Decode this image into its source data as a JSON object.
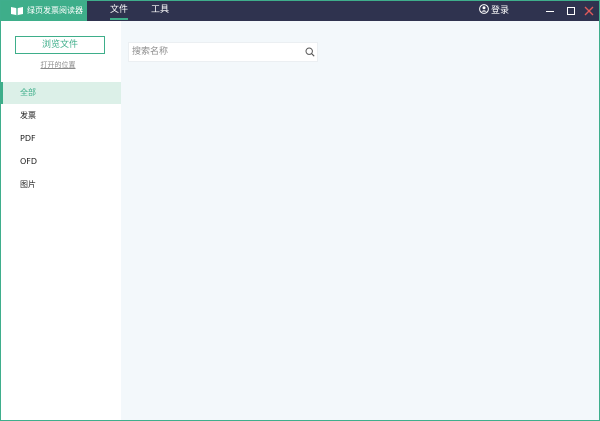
{
  "app": {
    "title": "绿页发票阅读器"
  },
  "menu": {
    "file_label": "文件",
    "tools_label": "工具"
  },
  "account": {
    "login_label": "登录"
  },
  "sidebar": {
    "browse_label": "浏览文件",
    "open_location_label": "打开的位置",
    "categories": [
      {
        "label": "全部",
        "active": true
      },
      {
        "label": "发票",
        "active": false
      },
      {
        "label": "PDF",
        "active": false
      },
      {
        "label": "OFD",
        "active": false
      },
      {
        "label": "图片",
        "active": false
      }
    ]
  },
  "search": {
    "placeholder": "搜索名称",
    "value": ""
  },
  "colors": {
    "accent": "#3eae8a",
    "titlebar": "#2f334f",
    "close": "#e25a5a"
  },
  "icons": {
    "brand": "book-icon",
    "login": "user-circle-icon",
    "search": "search-icon",
    "minimize": "minimize-icon",
    "maximize": "maximize-icon",
    "close": "close-icon"
  }
}
